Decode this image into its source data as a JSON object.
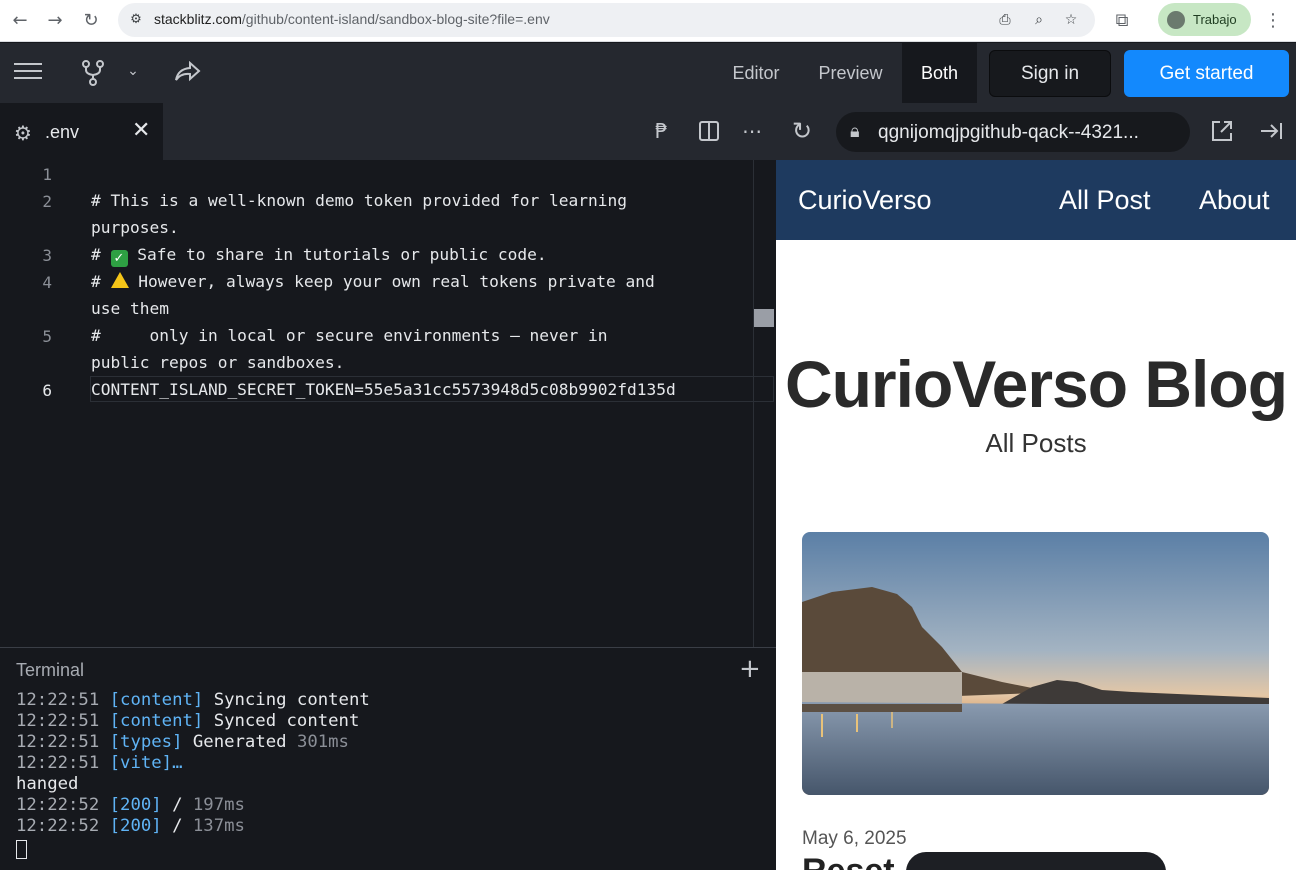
{
  "browser": {
    "url_host": "stackblitz.com",
    "url_path": "/github/content-island/sandbox-blog-site?file=.env",
    "profile_name": "Trabajo"
  },
  "toolbar": {
    "view_tabs": [
      "Editor",
      "Preview",
      "Both"
    ],
    "active_view": "Both",
    "signin_label": "Sign in",
    "getstarted_label": "Get started",
    "accent_color": "#1389fd"
  },
  "editor": {
    "tab_name": ".env",
    "lines": [
      {
        "n": "1",
        "text": ""
      },
      {
        "n": "2",
        "text": "# This is a well-known demo token provided for learning",
        "cont": "purposes."
      },
      {
        "n": "3",
        "pre": "# ",
        "emoji": "check",
        "text": " Safe to share in tutorials or public code."
      },
      {
        "n": "4",
        "pre": "# ",
        "emoji": "warning",
        "text": " However, always keep your own real tokens private and",
        "cont": "use them"
      },
      {
        "n": "5",
        "text": "#     only in local or secure environments — never in",
        "cont": "public repos or sandboxes."
      },
      {
        "n": "6",
        "text": "CONTENT_ISLAND_SECRET_TOKEN=55e5a31cc5573948d5c08b9902fd135d"
      }
    ]
  },
  "preview_bar": {
    "address": "qgnijomqjpgithub-qack--4321..."
  },
  "terminal": {
    "title": "Terminal",
    "lines": [
      {
        "ts": "12:22:51",
        "tag": "[content]",
        "msg": "Syncing content",
        "dim": ""
      },
      {
        "ts": "12:22:51",
        "tag": "[content]",
        "msg": "Synced content",
        "dim": ""
      },
      {
        "ts": "12:22:51",
        "tag": "[types]",
        "msg": "Generated",
        "dim": "301ms"
      },
      {
        "ts": "12:22:51",
        "tag": "[vite]…",
        "msg": "",
        "dim": ""
      },
      {
        "ts": "",
        "tag": "",
        "msg": "hanged",
        "dim": ""
      },
      {
        "ts": "12:22:52",
        "tag": "[200]",
        "msg": "/",
        "dim": "197ms"
      },
      {
        "ts": "12:22:52",
        "tag": "[200]",
        "msg": "/",
        "dim": "137ms"
      }
    ]
  },
  "site": {
    "brand": "CurioVerso",
    "nav_links": [
      "All Post",
      "About"
    ],
    "title": "CurioVerso Blog",
    "subtitle": "All Posts",
    "post_date": "May 6, 2025",
    "post_title_peek": "Reset",
    "nav_color": "#1e3a5f"
  }
}
